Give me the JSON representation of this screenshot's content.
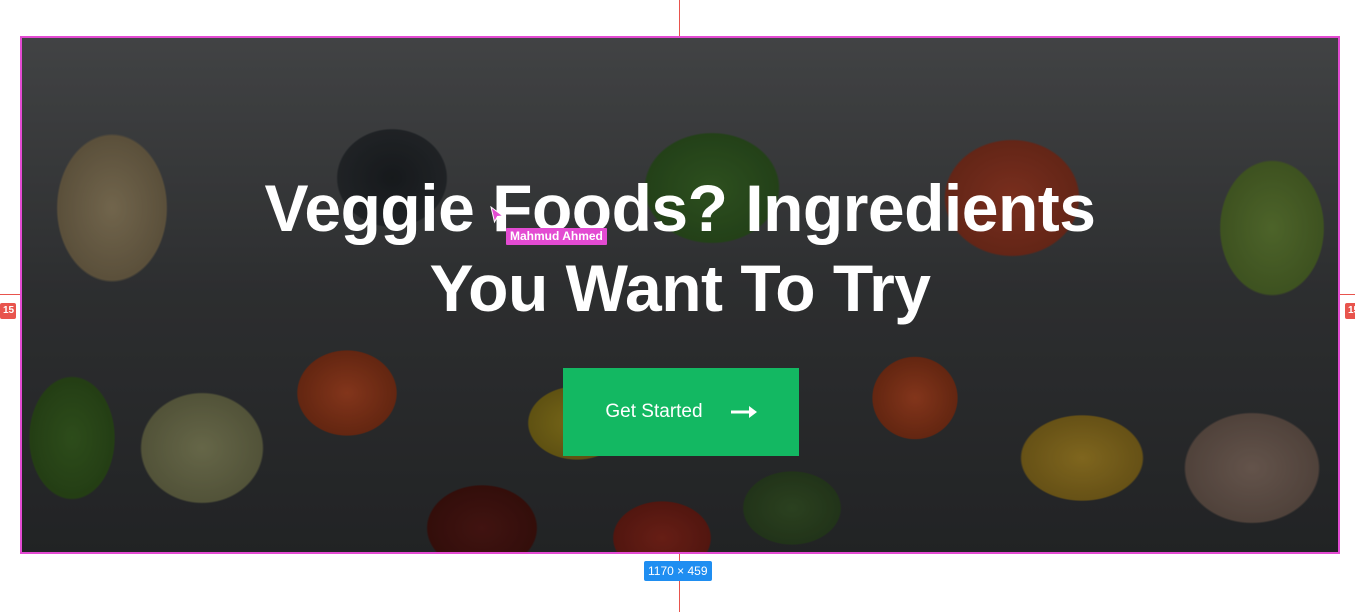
{
  "hero": {
    "title_line_1": "Veggie Foods? Ingredients",
    "title_line_2": "You Want To Try",
    "cta_label": "Get Started",
    "cta_icon": "arrow-right-icon",
    "cta_color": "#13b862",
    "frame_color": "#e34bd2"
  },
  "design_tool": {
    "collaborator_name": "Mahmud Ahmed",
    "collaborator_color": "#e34bd2",
    "selection_size": "1170 × 459",
    "size_badge_color": "#1f8ef1",
    "distance_left": "15",
    "distance_right": "15",
    "guide_color": "#e8544d"
  }
}
